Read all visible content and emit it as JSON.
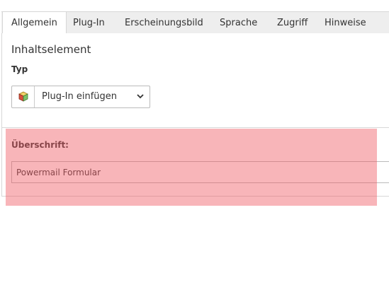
{
  "tabs": [
    {
      "label": "Allgemein",
      "active": true
    },
    {
      "label": "Plug-In",
      "active": false
    },
    {
      "label": "Erscheinungsbild",
      "active": false
    },
    {
      "label": "Sprache",
      "active": false
    },
    {
      "label": "Zugriff",
      "active": false
    },
    {
      "label": "Hinweise",
      "active": false
    }
  ],
  "content": {
    "section_title": "Inhaltselement",
    "type_label": "Typ",
    "type_select": {
      "value": "Plug-In einfügen",
      "icon": "plugin-cube-icon"
    },
    "heading_label": "Überschrift:",
    "heading_value": "Powermail Formular"
  },
  "colors": {
    "highlight": "#f05a64",
    "tab_bar": "#eeeeee",
    "border": "#d7d7d7"
  }
}
